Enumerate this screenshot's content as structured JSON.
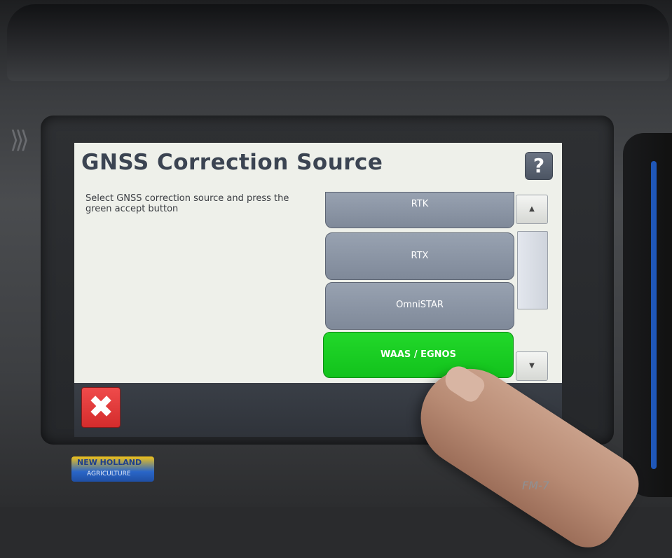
{
  "screen": {
    "title": "GNSS Correction Source",
    "help_label": "?",
    "instruction": "Select GNSS correction source and press the green accept button"
  },
  "options": [
    {
      "label": "RTK",
      "selected": false
    },
    {
      "label": "RTX",
      "selected": false
    },
    {
      "label": "OmniSTAR",
      "selected": false
    },
    {
      "label": "WAAS / EGNOS",
      "selected": true
    }
  ],
  "scrollbar": {
    "up_arrow": "▲",
    "down_arrow": "▼",
    "up_icon": "chevron-up-icon",
    "down_icon": "chevron-down-icon"
  },
  "footer": {
    "cancel_label": "✖",
    "cancel_icon": "close-icon"
  },
  "device": {
    "brand": "NEW HOLLAND",
    "brand_sub": "AGRICULTURE",
    "model": "FM-7"
  },
  "colors": {
    "screen_bg": "#eef0ea",
    "title": "#3b4452",
    "option": "#8a94a3",
    "selected_option": "#19cc22",
    "cancel": "#e03a3a",
    "bottom_bar": "#343941"
  }
}
